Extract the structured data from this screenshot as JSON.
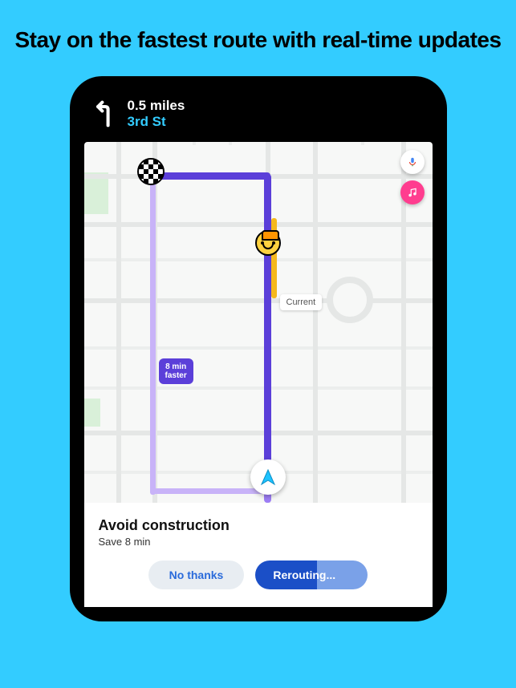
{
  "headline": "Stay on the fastest route with real-time updates",
  "nav": {
    "distance": "0.5 miles",
    "street": "3rd St"
  },
  "map": {
    "current_label": "Current",
    "faster_bubble": "8 min\nfaster",
    "icons": {
      "voice": "voice-icon",
      "music": "music-icon",
      "construction": "construction-worker-icon",
      "destination": "checkered-flag-icon",
      "cursor": "navigation-arrow-icon",
      "turn": "turn-left-icon"
    },
    "colors": {
      "route": "#5b3fd9",
      "alternate": "#c8b3f8",
      "hazard": "#f5b81c",
      "accent_pink": "#ff3d8f",
      "page_bg": "#33ccff"
    }
  },
  "sheet": {
    "title": "Avoid construction",
    "subtitle": "Save 8 min",
    "no_thanks": "No thanks",
    "rerouting": "Rerouting..."
  }
}
